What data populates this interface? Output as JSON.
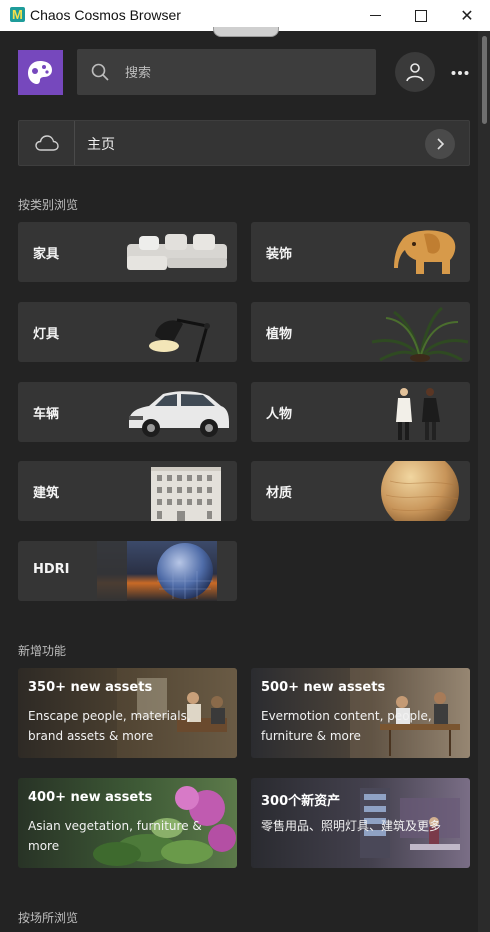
{
  "window": {
    "title": "Chaos Cosmos Browser",
    "app_icon_letter": "M",
    "minimize": "minimize",
    "maximize": "maximize",
    "close": "✕"
  },
  "header": {
    "search_placeholder": "搜索",
    "logo_icon": "cosmos-logo-icon",
    "account_icon": "user-icon",
    "more_icon": "more-dots-icon"
  },
  "breadcrumb": {
    "icon": "cloud-icon",
    "label": "主页",
    "next_icon": "chevron-right-icon"
  },
  "sections": {
    "categories_title": "按类别浏览",
    "features_title": "新增功能",
    "places_title": "按场所浏览"
  },
  "categories": [
    {
      "label": "家具",
      "image": "sofa"
    },
    {
      "label": "装饰",
      "image": "elephant"
    },
    {
      "label": "灯具",
      "image": "lamp"
    },
    {
      "label": "植物",
      "image": "palm"
    },
    {
      "label": "车辆",
      "image": "car"
    },
    {
      "label": "人物",
      "image": "people"
    },
    {
      "label": "建筑",
      "image": "building"
    },
    {
      "label": "材质",
      "image": "sphere"
    },
    {
      "label": "HDRI",
      "image": "hdri"
    }
  ],
  "features": [
    {
      "title": "350+ new assets",
      "desc": "Enscape people, materials, brand assets & more"
    },
    {
      "title": "500+ new assets",
      "desc": "Evermotion content, people, furniture & more"
    },
    {
      "title": "400+ new assets",
      "desc": "Asian vegetation, furniture & more"
    },
    {
      "title": "300个新资产",
      "desc": "零售用品、照明灯具、建筑及更多"
    }
  ],
  "colors": {
    "background": "#232323",
    "card": "#353535",
    "brand": "#7648bd",
    "search_bg": "#3d3d3d"
  }
}
